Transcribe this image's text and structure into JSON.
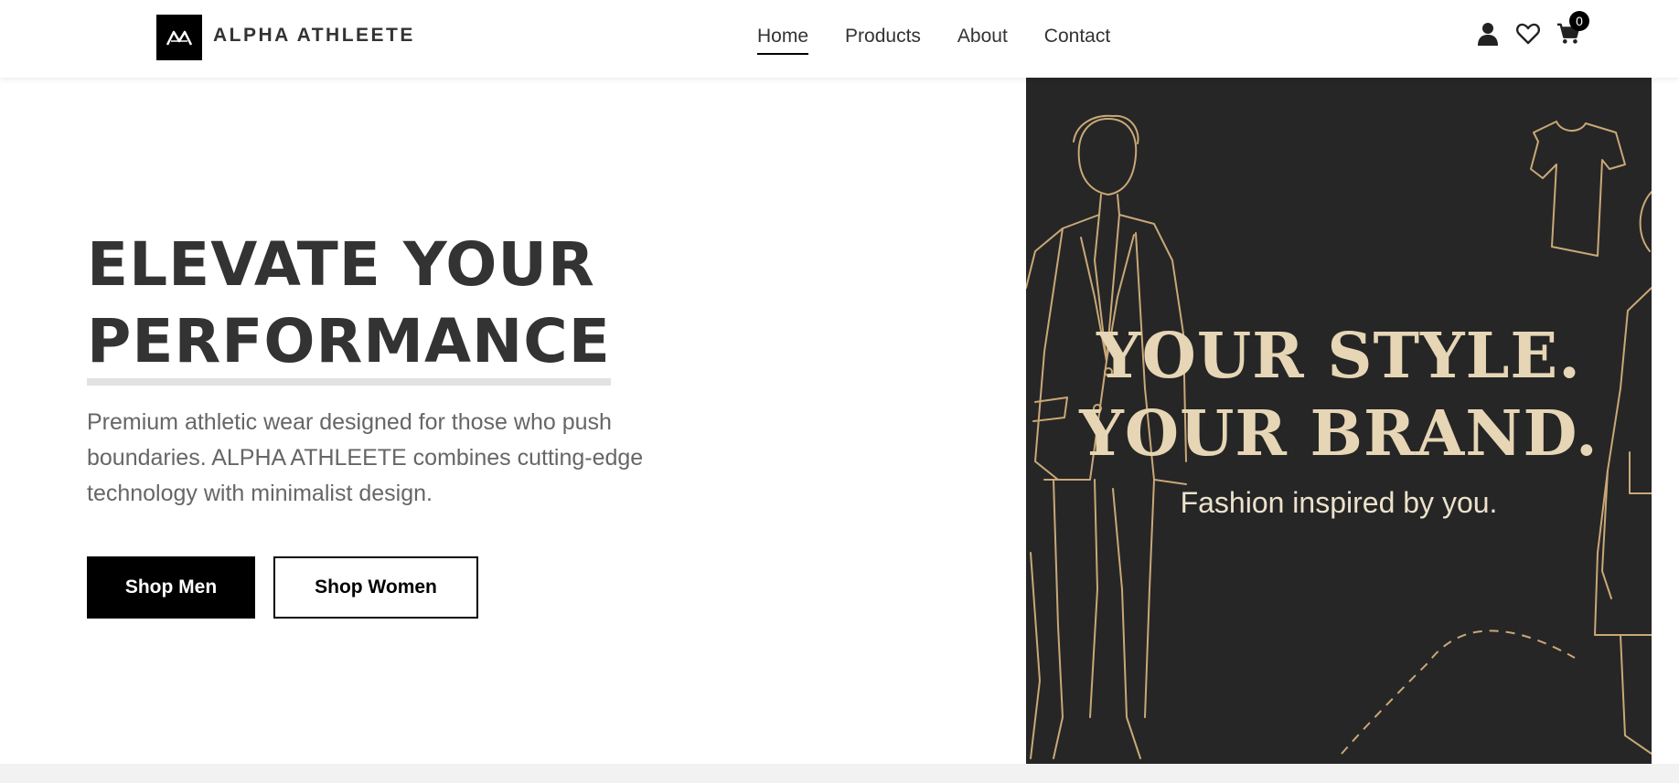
{
  "brand": {
    "name": "ALPHA ATHLEETE",
    "logo_icon": "mountain-logo-icon"
  },
  "nav": {
    "items": [
      {
        "label": "Home",
        "active": true
      },
      {
        "label": "Products",
        "active": false
      },
      {
        "label": "About",
        "active": false
      },
      {
        "label": "Contact",
        "active": false
      }
    ]
  },
  "header_icons": {
    "account": "user-icon",
    "wishlist": "heart-icon",
    "cart": "cart-icon",
    "cart_count": "0"
  },
  "hero": {
    "title_line1": "ELEVATE YOUR",
    "title_line2": "PERFORMANCE",
    "description": "Premium athletic wear designed for those who push boundaries. ALPHA ATHLEETE combines cutting-edge technology with minimalist design.",
    "button_men": "Shop Men",
    "button_women": "Shop Women"
  },
  "hero_image": {
    "heading_line1": "YOUR STYLE.",
    "heading_line2": "YOUR BRAND.",
    "subheading": "Fashion inspired by you.",
    "colors": {
      "background": "#262626",
      "lineart": "#c9a877",
      "text": "#e6d6b6"
    }
  }
}
